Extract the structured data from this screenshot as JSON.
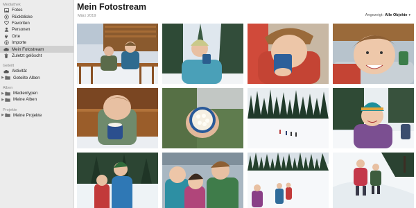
{
  "sidebar": {
    "library_header": "Mediathek",
    "library_items": [
      {
        "label": "Fotos",
        "icon": "photos-icon"
      },
      {
        "label": "Rückblicke",
        "icon": "memories-icon"
      },
      {
        "label": "Favoriten",
        "icon": "heart-icon"
      },
      {
        "label": "Personen",
        "icon": "people-icon"
      },
      {
        "label": "Orte",
        "icon": "map-pin-icon"
      },
      {
        "label": "Importe",
        "icon": "import-icon"
      },
      {
        "label": "Mein Fotostream",
        "icon": "cloud-icon",
        "selected": true
      },
      {
        "label": "Zuletzt gelöscht",
        "icon": "trash-icon"
      }
    ],
    "shared_header": "Geteilt",
    "shared_items": [
      {
        "label": "Aktivität",
        "icon": "cloud-icon"
      },
      {
        "label": "Geteilte Alben",
        "icon": "shared-folder-icon"
      }
    ],
    "albums_header": "Alben",
    "album_items": [
      {
        "label": "Medientypen",
        "icon": "folder-icon"
      },
      {
        "label": "Meine Alben",
        "icon": "folder-icon"
      }
    ],
    "projects_header": "Projekte",
    "project_items": [
      {
        "label": "Meine Projekte",
        "icon": "folder-icon"
      }
    ]
  },
  "main": {
    "title": "Mein Fotostream",
    "date": "März 2019",
    "showing_label": "Angezeigt:",
    "showing_value": "Alle Objekte"
  },
  "photos": [
    {
      "name": "photo-kids-on-balcony"
    },
    {
      "name": "photo-boy-with-mug-in-snow"
    },
    {
      "name": "photo-boy-drinking-from-mug"
    },
    {
      "name": "photo-boy-smiling-closeup"
    },
    {
      "name": "photo-boy-with-marshmallow-cup"
    },
    {
      "name": "photo-cup-of-marshmallows"
    },
    {
      "name": "photo-snowshoers-distance"
    },
    {
      "name": "photo-girl-in-snow"
    },
    {
      "name": "photo-kids-forest-walk"
    },
    {
      "name": "photo-kids-selfie"
    },
    {
      "name": "photo-kids-snowshoeing"
    },
    {
      "name": "photo-kids-snowy-slope"
    }
  ],
  "colors": {
    "sidebar_bg": "#ececec",
    "selected_row": "#d0d0d0",
    "sidebar_icon": "#555555"
  }
}
